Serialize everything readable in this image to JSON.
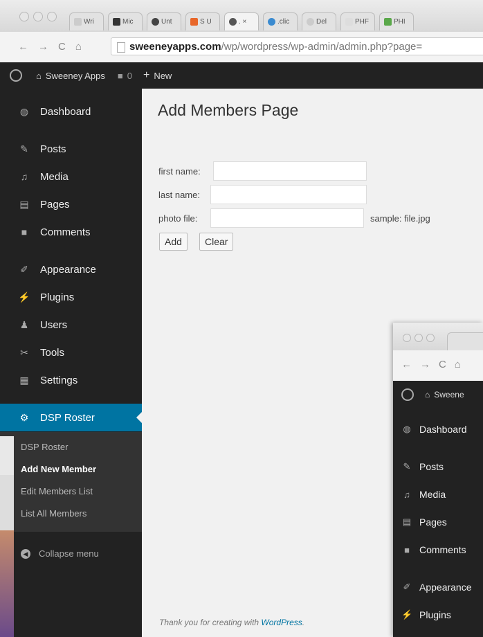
{
  "browser": {
    "tabs": [
      {
        "label": "Wri",
        "color": "#cccccc"
      },
      {
        "label": "Mic",
        "color": "#333333"
      },
      {
        "label": "Unt",
        "color": "#444444"
      },
      {
        "label": "S U",
        "color": "#e8672a"
      },
      {
        "label": ". ×",
        "color": "#555555"
      },
      {
        "label": ".clic",
        "color": "#3b8bd0"
      },
      {
        "label": "Del",
        "color": "#cccccc"
      },
      {
        "label": "PHF",
        "color": "#dddddd"
      },
      {
        "label": "PHI",
        "color": "#5aa84a"
      }
    ],
    "url_domain": "sweeneyapps.com",
    "url_path": "/wp/wordpress/wp-admin/admin.php?page=",
    "back": "←",
    "forward": "→",
    "reload": "C",
    "home": "⌂"
  },
  "adminbar": {
    "site_name": "Sweeney Apps",
    "comments_count": "0",
    "new_label": "New"
  },
  "sidebar": {
    "items": [
      {
        "label": "Dashboard",
        "icon": "dashboard-icon",
        "glyph": "◍"
      },
      {
        "label": "Posts",
        "icon": "pin-icon",
        "glyph": "✎"
      },
      {
        "label": "Media",
        "icon": "media-icon",
        "glyph": "♫"
      },
      {
        "label": "Pages",
        "icon": "pages-icon",
        "glyph": "▤"
      },
      {
        "label": "Comments",
        "icon": "comment-icon",
        "glyph": "■"
      },
      {
        "label": "Appearance",
        "icon": "brush-icon",
        "glyph": "✐"
      },
      {
        "label": "Plugins",
        "icon": "plug-icon",
        "glyph": "⚡"
      },
      {
        "label": "Users",
        "icon": "user-icon",
        "glyph": "♟"
      },
      {
        "label": "Tools",
        "icon": "wrench-icon",
        "glyph": "✂"
      },
      {
        "label": "Settings",
        "icon": "settings-icon",
        "glyph": "▦"
      },
      {
        "label": "DSP Roster",
        "icon": "gear-icon",
        "glyph": "⚙"
      }
    ],
    "submenu": [
      "DSP Roster",
      "Add New Member",
      "Edit Members List",
      "List All Members"
    ],
    "collapse": "Collapse menu"
  },
  "main": {
    "title": "Add Members Page",
    "first_name_label": "first name:",
    "last_name_label": "last name:",
    "photo_label": "photo file:",
    "sample_hint": "sample: file.jpg",
    "add_button": "Add",
    "clear_button": "Clear",
    "footer_text": "Thank you for creating with",
    "footer_link": "WordPress",
    "footer_end": "."
  },
  "nested": {
    "site_name": "Sweene",
    "items": [
      "Dashboard",
      "Posts",
      "Media",
      "Pages",
      "Comments",
      "Appearance",
      "Plugins"
    ]
  },
  "colors": {
    "admin_dark": "#222222",
    "accent_blue": "#0074a2"
  }
}
